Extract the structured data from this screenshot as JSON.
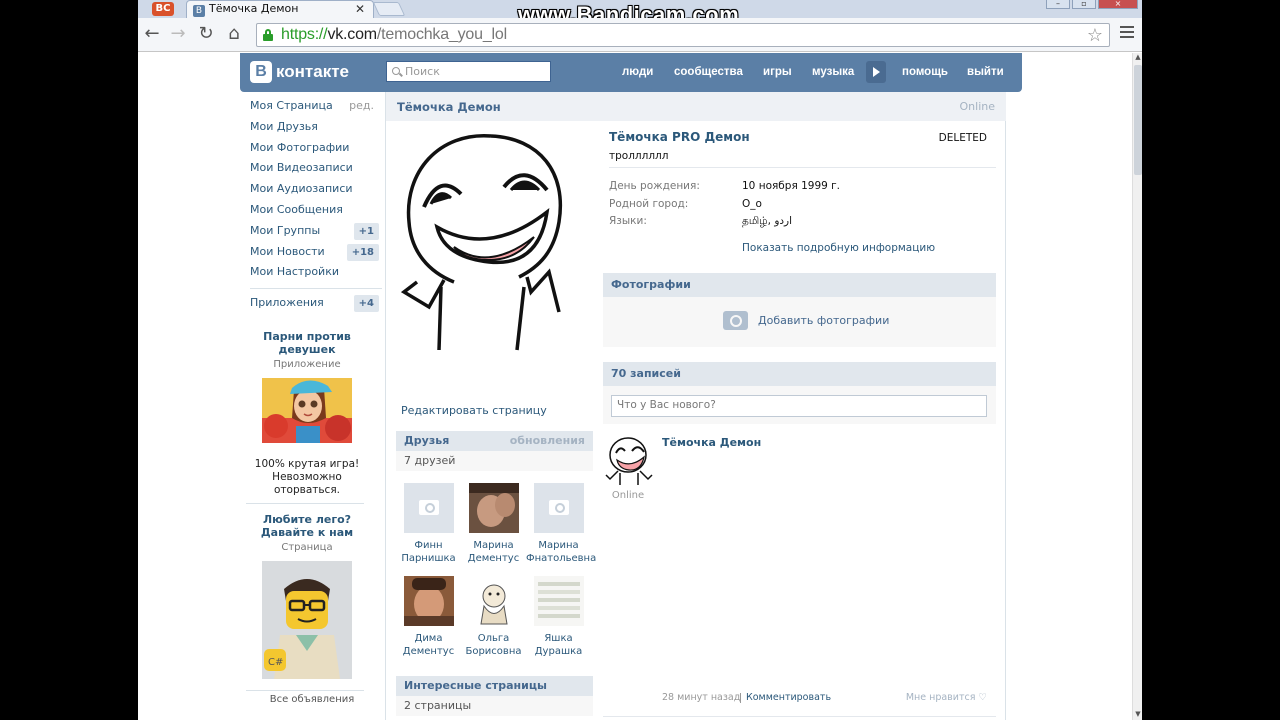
{
  "browser": {
    "tab_vc_logo": "ВС",
    "tab_title": "Тёмочка Демон",
    "tab_close": "✕",
    "url_protocol": "https://",
    "url_host": "vk.com",
    "url_path": "/temochka_you_lol",
    "watermark": "www.Bandicam.com"
  },
  "header": {
    "logo_letter": "В",
    "logo_text": "контакте",
    "search_placeholder": "Поиск",
    "nav": [
      "люди",
      "сообщества",
      "игры",
      "музыка",
      "помощь",
      "выйти"
    ]
  },
  "left_menu": {
    "items": [
      {
        "label": "Моя Страница",
        "extra": "ред."
      },
      {
        "label": "Мои Друзья"
      },
      {
        "label": "Мои Фотографии"
      },
      {
        "label": "Мои Видеозаписи"
      },
      {
        "label": "Мои Аудиозаписи"
      },
      {
        "label": "Мои Сообщения"
      },
      {
        "label": "Мои Группы",
        "badge": "+1"
      },
      {
        "label": "Мои Новости",
        "badge": "+18"
      },
      {
        "label": "Мои Настройки"
      }
    ],
    "apps": {
      "label": "Приложения",
      "badge": "+4"
    }
  },
  "ads": [
    {
      "title": "Парни против девушек",
      "subtitle": "Приложение",
      "text": "100% крутая игра! Невозможно оторваться."
    },
    {
      "title": "Любите лего? Давайте к нам",
      "subtitle": "Страница"
    }
  ],
  "all_ads": "Все объявления",
  "profile": {
    "owner": "Тёмочка Демон",
    "online": "Online",
    "full_name": "Тёмочка PRO Демон",
    "deleted": "DELETED",
    "status": "тролллллл",
    "edit_page": "Редактировать страницу",
    "info": [
      {
        "label": "День рождения:",
        "value": "10 ноября 1999 г."
      },
      {
        "label": "Родной город:",
        "value": "О_о"
      },
      {
        "label": "Языки:",
        "value": "தமிழ், اردو"
      }
    ],
    "show_details": "Показать подробную информацию"
  },
  "friends": {
    "title": "Друзья",
    "updates": "обновления",
    "count": "7 друзей",
    "list": [
      {
        "first": "Финн",
        "last": "Парнишка"
      },
      {
        "first": "Марина",
        "last": "Дементус"
      },
      {
        "first": "Марина",
        "last": "Фнатольевна"
      },
      {
        "first": "Дима",
        "last": "Дементус"
      },
      {
        "first": "Ольга",
        "last": "Борисовна"
      },
      {
        "first": "Яшка",
        "last": "Дурашка"
      }
    ]
  },
  "interesting": {
    "title": "Интересные страницы",
    "count": "2 страницы"
  },
  "photos": {
    "title": "Фотографии",
    "add": "Добавить фотографии"
  },
  "wall": {
    "count": "70 записей",
    "placeholder": "Что у Вас нового?",
    "post": {
      "author": "Тёмочка Демон",
      "online": "Online",
      "time": "28 минут назад",
      "comment": "Комментировать",
      "like": "Мне нравится"
    }
  },
  "colors": {
    "vk_blue": "#5b7fa6",
    "link": "#2b587a"
  }
}
